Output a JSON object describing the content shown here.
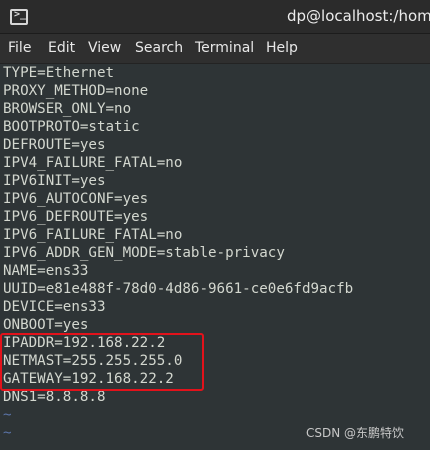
{
  "window": {
    "title": "dp@localhost:/home/"
  },
  "icons": {
    "terminal": "terminal-icon"
  },
  "menu": {
    "items": [
      "File",
      "Edit",
      "View",
      "Search",
      "Terminal",
      "Help"
    ]
  },
  "lines": [
    "TYPE=Ethernet",
    "PROXY_METHOD=none",
    "BROWSER_ONLY=no",
    "BOOTPROTO=static",
    "DEFROUTE=yes",
    "IPV4_FAILURE_FATAL=no",
    "IPV6INIT=yes",
    "IPV6_AUTOCONF=yes",
    "IPV6_DEFROUTE=yes",
    "IPV6_FAILURE_FATAL=no",
    "IPV6_ADDR_GEN_MODE=stable-privacy",
    "NAME=ens33",
    "UUID=e81e488f-78d0-4d86-9661-ce0e6fd9acfb",
    "DEVICE=ens33",
    "ONBOOT=yes",
    "IPADDR=192.168.22.2",
    "NETMAST=255.255.255.0",
    "GATEWAY=192.168.22.2",
    "DNS1=8.8.8.8"
  ],
  "empty_lines": [
    "~",
    "~"
  ],
  "watermark": "CSDN @东鹏特饮",
  "colors": {
    "background": "#2e3436",
    "text": "#d3d7cf",
    "highlight_border": "#e3121b",
    "tilde": "#5a73a6"
  }
}
